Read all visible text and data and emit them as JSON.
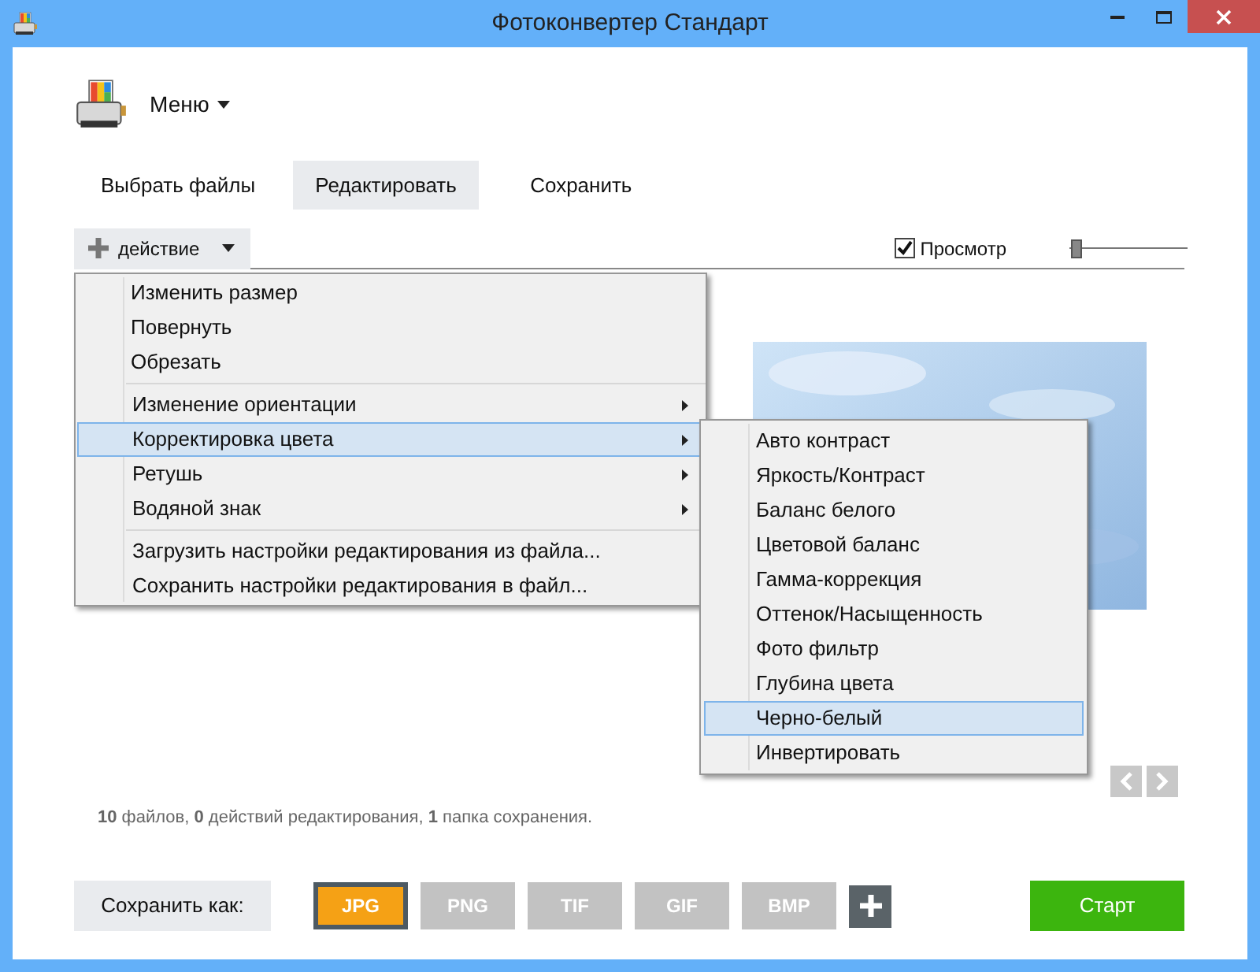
{
  "window": {
    "title": "Фотоконвертер Стандарт"
  },
  "app_menu": {
    "label": "Меню"
  },
  "tabs": [
    {
      "label": "Выбрать файлы",
      "selected": false
    },
    {
      "label": "Редактировать",
      "selected": true
    },
    {
      "label": "Сохранить",
      "selected": false
    }
  ],
  "action_button": {
    "label": "действие"
  },
  "preview": {
    "label": "Просмотр",
    "checked": true
  },
  "zoom_slider": {
    "level": 0.02
  },
  "action_menu": {
    "groups": [
      [
        {
          "label": "Изменить размер",
          "has_submenu": false,
          "selected": false
        },
        {
          "label": "Повернуть",
          "has_submenu": false,
          "selected": false
        },
        {
          "label": "Обрезать",
          "has_submenu": false,
          "selected": false
        }
      ],
      [
        {
          "label": "Изменение ориентации",
          "has_submenu": true,
          "selected": false
        },
        {
          "label": "Корректировка цвета",
          "has_submenu": true,
          "selected": true
        },
        {
          "label": "Ретушь",
          "has_submenu": true,
          "selected": false
        },
        {
          "label": "Водяной знак",
          "has_submenu": true,
          "selected": false
        }
      ],
      [
        {
          "label": "Загрузить настройки редактирования из файла...",
          "has_submenu": false,
          "selected": false
        },
        {
          "label": "Сохранить настройки редактирования в файл...",
          "has_submenu": false,
          "selected": false
        }
      ]
    ]
  },
  "color_submenu": [
    {
      "label": "Авто контраст",
      "selected": false
    },
    {
      "label": "Яркость/Контраст",
      "selected": false
    },
    {
      "label": "Баланс белого",
      "selected": false
    },
    {
      "label": "Цветовой баланс",
      "selected": false
    },
    {
      "label": "Гамма-коррекция",
      "selected": false
    },
    {
      "label": "Оттенок/Насыщенность",
      "selected": false
    },
    {
      "label": "Фото фильтр",
      "selected": false
    },
    {
      "label": "Глубина цвета",
      "selected": false
    },
    {
      "label": "Черно-белый",
      "selected": true
    },
    {
      "label": "Инвертировать",
      "selected": false
    }
  ],
  "status": "**10** файлов, **0** действий редактирования, **1** папка сохранения.",
  "save_as": {
    "label": "Сохранить как:"
  },
  "formats": [
    {
      "label": "JPG",
      "selected": true
    },
    {
      "label": "PNG",
      "selected": false
    },
    {
      "label": "TIF",
      "selected": false
    },
    {
      "label": "GIF",
      "selected": false
    },
    {
      "label": "BMP",
      "selected": false
    }
  ],
  "start_button": {
    "label": "Старт"
  }
}
